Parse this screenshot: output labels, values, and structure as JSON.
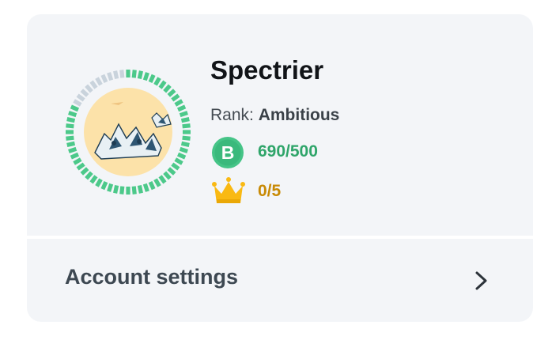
{
  "profile": {
    "username": "Spectrier",
    "rank_label": "Rank:",
    "rank_value": "Ambitious",
    "progress_fraction": 0.84,
    "colors": {
      "ring_filled": "#4cc98a",
      "ring_empty": "#c9d3dc",
      "avatar_bg": "#fce2a9"
    },
    "points": {
      "icon": "b-coin-icon",
      "icon_letter": "B",
      "value": "690/500",
      "color": "#2fa56a"
    },
    "crowns": {
      "icon": "crown-icon",
      "value": "0/5",
      "color": "#c88a05"
    }
  },
  "settings": {
    "label": "Account settings",
    "icon": "chevron-right-icon"
  }
}
